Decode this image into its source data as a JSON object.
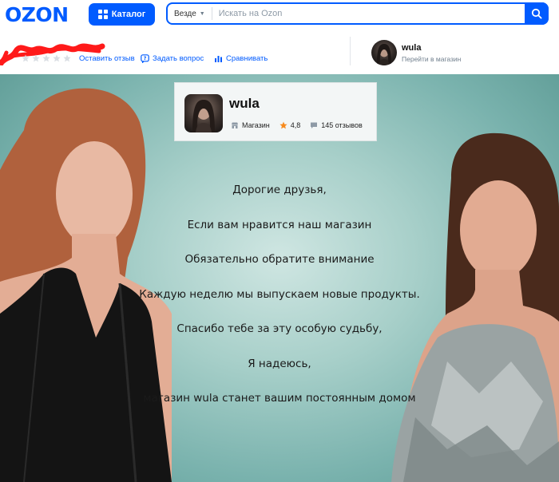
{
  "header": {
    "logo": "OZON",
    "catalog_label": "Каталог",
    "search_scope": "Везде",
    "search_placeholder": "Искать на Ozon"
  },
  "product_bar": {
    "rating_stars": 0,
    "actions": {
      "review": "Оставить отзыв",
      "question": "Задать вопрос",
      "compare": "Сравнивать"
    }
  },
  "store": {
    "name": "wula",
    "subtitle": "Перейти в магазин"
  },
  "banner_card": {
    "name": "wula",
    "type_label": "Магазин",
    "rating": "4,8",
    "reviews": "145 отзывов"
  },
  "banner_text": [
    "Дорогие друзья,",
    "Если вам нравится наш магазин",
    "Обязательно обратите внимание",
    "Каждую неделю мы выпускаем новые продукты.",
    "Спасибо тебе за эту особую судьбу,",
    "Я надеюсь,",
    "магазин wula станет вашим постоянным домом"
  ],
  "colors": {
    "brand": "#005bff",
    "banner_bg": "#a7cfc9",
    "star_rating": "#f78a1d",
    "redaction": "#ff1a1a"
  }
}
